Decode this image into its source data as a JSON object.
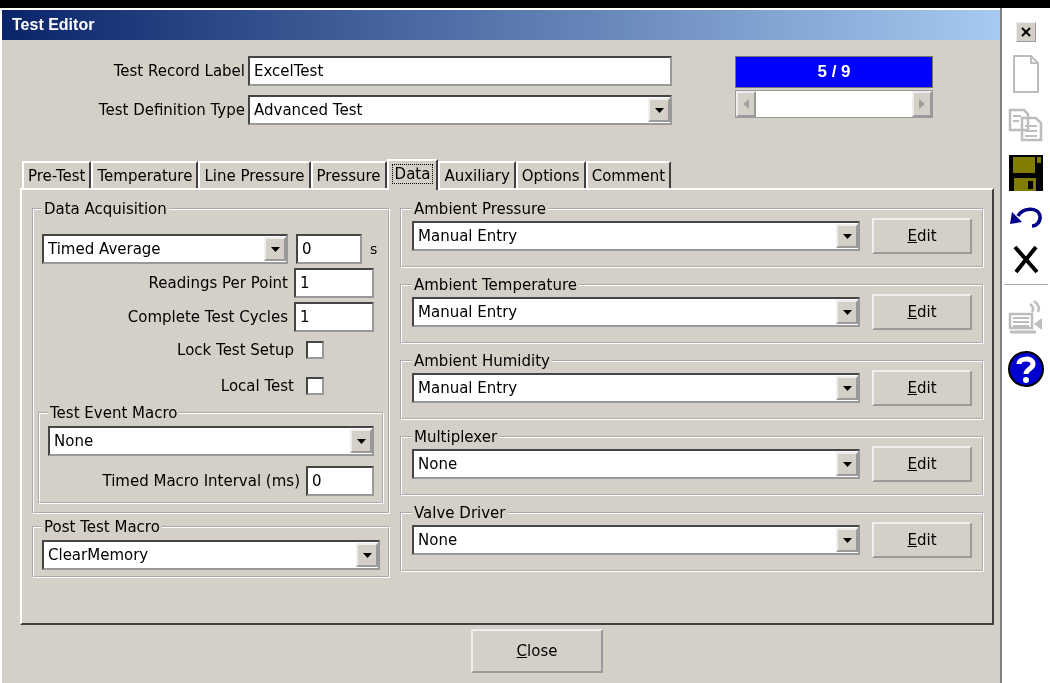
{
  "window": {
    "title": "Test Editor"
  },
  "header": {
    "record_label": {
      "label": "Test Record Label",
      "value": "ExcelTest"
    },
    "definition_type": {
      "label": "Test Definition Type",
      "value": "Advanced Test"
    },
    "counter": "5 / 9"
  },
  "tabs": [
    {
      "label": "Pre-Test",
      "selected": false
    },
    {
      "label": "Temperature",
      "selected": false
    },
    {
      "label": "Line Pressure",
      "selected": false
    },
    {
      "label": "Pressure",
      "selected": false
    },
    {
      "label": "Data",
      "selected": true
    },
    {
      "label": "Auxiliary",
      "selected": false
    },
    {
      "label": "Options",
      "selected": false
    },
    {
      "label": "Comment",
      "selected": false
    }
  ],
  "data_acquisition": {
    "title": "Data Acquisition",
    "mode": "Timed Average",
    "interval": "0",
    "unit": "s",
    "fields": [
      {
        "label": "Readings Per Point",
        "value": "1"
      },
      {
        "label": "Complete Test Cycles",
        "value": "1"
      }
    ],
    "checks": [
      {
        "label": "Lock Test Setup",
        "checked": false
      },
      {
        "label": "Local Test",
        "checked": false
      }
    ]
  },
  "test_event_macro": {
    "title": "Test Event Macro",
    "value": "None",
    "interval_label": "Timed Macro Interval (ms)",
    "interval_value": "0"
  },
  "post_test_macro": {
    "title": "Post Test Macro",
    "value": "ClearMemory"
  },
  "sources": [
    {
      "title": "Ambient Pressure",
      "value": "Manual Entry",
      "button": "Edit"
    },
    {
      "title": "Ambient Temperature",
      "value": "Manual Entry",
      "button": "Edit"
    },
    {
      "title": "Ambient Humidity",
      "value": "Manual Entry",
      "button": "Edit"
    },
    {
      "title": "Multiplexer",
      "value": "None",
      "button": "Edit"
    },
    {
      "title": "Valve Driver",
      "value": "None",
      "button": "Edit"
    }
  ],
  "close_button": "Close",
  "toolbar": [
    {
      "disabled": true
    },
    {
      "disabled": true
    },
    {
      "disabled": false
    },
    {
      "disabled": false
    },
    {
      "disabled": false
    },
    {
      "disabled": true
    },
    {
      "disabled": false
    }
  ]
}
